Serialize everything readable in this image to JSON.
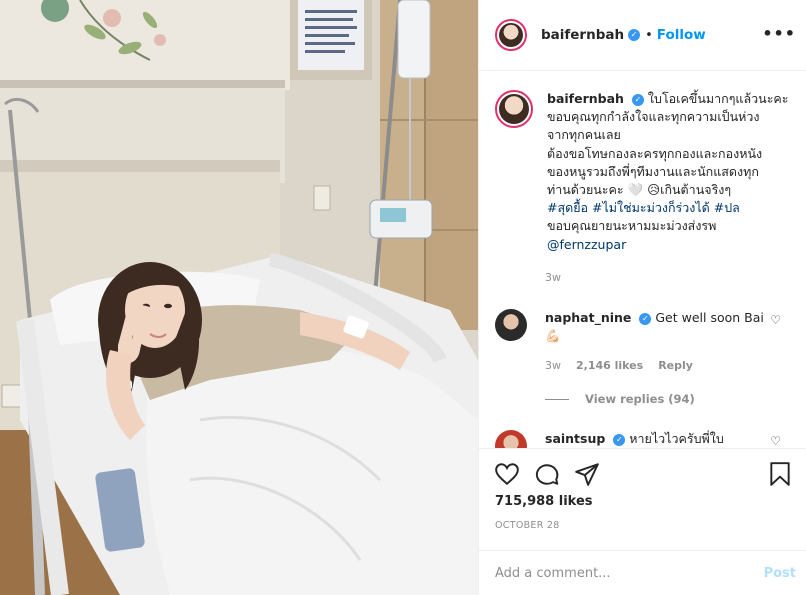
{
  "post": {
    "username": "baifernbah",
    "verified": true,
    "follow_label": "Follow",
    "separator": "•",
    "more_label": "•••"
  },
  "caption": {
    "username": "baifernbah",
    "text_line1": "ใบโอเคขึ้นมากๆแล้วนะคะ",
    "text_line2": "ขอบคุณทุกกำลังใจและทุกความเป็นห่วง",
    "text_line3": "จากทุกคนเลย",
    "text_line4": "ต้องขอโทษกองละครทุกกองและกองหนัง",
    "text_line5": "ของหนูรวมถึงพี่ๆทีมงานและนักแสดงทุก",
    "text_line6_before": "ท่านด้วยนะคะ",
    "text_line6_emoji": "🤍 😥",
    "text_line6_after": "เกินต้านจริงๆ",
    "hashtag1": "#สุดยื้อ",
    "hashtag2": "#ไม่ใช่มะม่วงก็ร่วงได้",
    "hashtag3": "#ปล",
    "text_line8": "ขอบคุณยายนะหามมะม่วงส่งรพ",
    "mention": "@fernzzupar",
    "time": "3w"
  },
  "comments": [
    {
      "username": "naphat_nine",
      "verified": true,
      "text": "Get well soon Bai",
      "emoji": "💪🏻",
      "time": "3w",
      "likes": "2,146 likes",
      "reply_label": "Reply",
      "view_replies": "View replies (94)"
    },
    {
      "username": "saintsup",
      "verified": true,
      "text": "หายไวไวครับพี่ใบ"
    }
  ],
  "actions": {
    "like_icon": "heart-outline-icon",
    "comment_icon": "comment-bubble-icon",
    "share_icon": "paper-plane-icon",
    "save_icon": "bookmark-icon"
  },
  "likes_count": "715,988 likes",
  "date": "OCTOBER 28",
  "add_comment": {
    "placeholder": "Add a comment...",
    "post_label": "Post"
  },
  "colors": {
    "link_blue": "#0095f6",
    "hashtag": "#00376b",
    "muted": "#8e8e8e",
    "post_disabled": "#b2dffc",
    "border": "#efefef"
  }
}
